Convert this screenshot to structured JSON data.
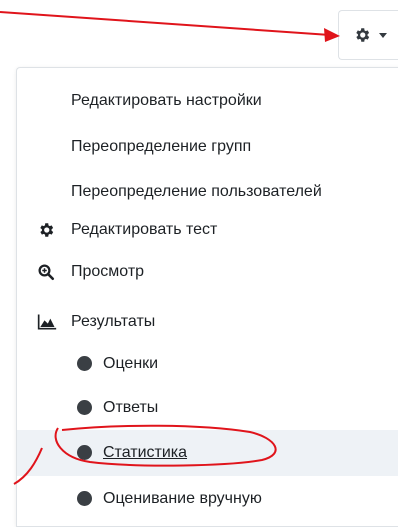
{
  "gear_button": {
    "icon": "gear-icon",
    "caret": "caret-down-icon"
  },
  "menu": {
    "items": [
      {
        "label": "Редактировать настройки",
        "icon": null,
        "level": 1
      },
      {
        "label": "Переопределение групп",
        "icon": null,
        "level": 1
      },
      {
        "label": "Переопределение пользователей",
        "icon": null,
        "level": 1
      },
      {
        "label": "Редактировать тест",
        "icon": "cog-icon",
        "level": 1
      },
      {
        "label": "Просмотр",
        "icon": "zoom-in-icon",
        "level": 1
      },
      {
        "label": "Результаты",
        "icon": "area-chart-icon",
        "level": 1
      },
      {
        "label": "Оценки",
        "icon": "bullet-icon",
        "level": 2
      },
      {
        "label": "Ответы",
        "icon": "bullet-icon",
        "level": 2
      },
      {
        "label": "Статистика",
        "icon": "bullet-icon",
        "level": 2,
        "active": true
      },
      {
        "label": "Оценивание вручную",
        "icon": "bullet-icon",
        "level": 2
      }
    ]
  },
  "colors": {
    "annotation_red": "#e0141b",
    "active_row": "#eef2f6",
    "text": "#1d2125",
    "bullet": "#3a3f44"
  }
}
